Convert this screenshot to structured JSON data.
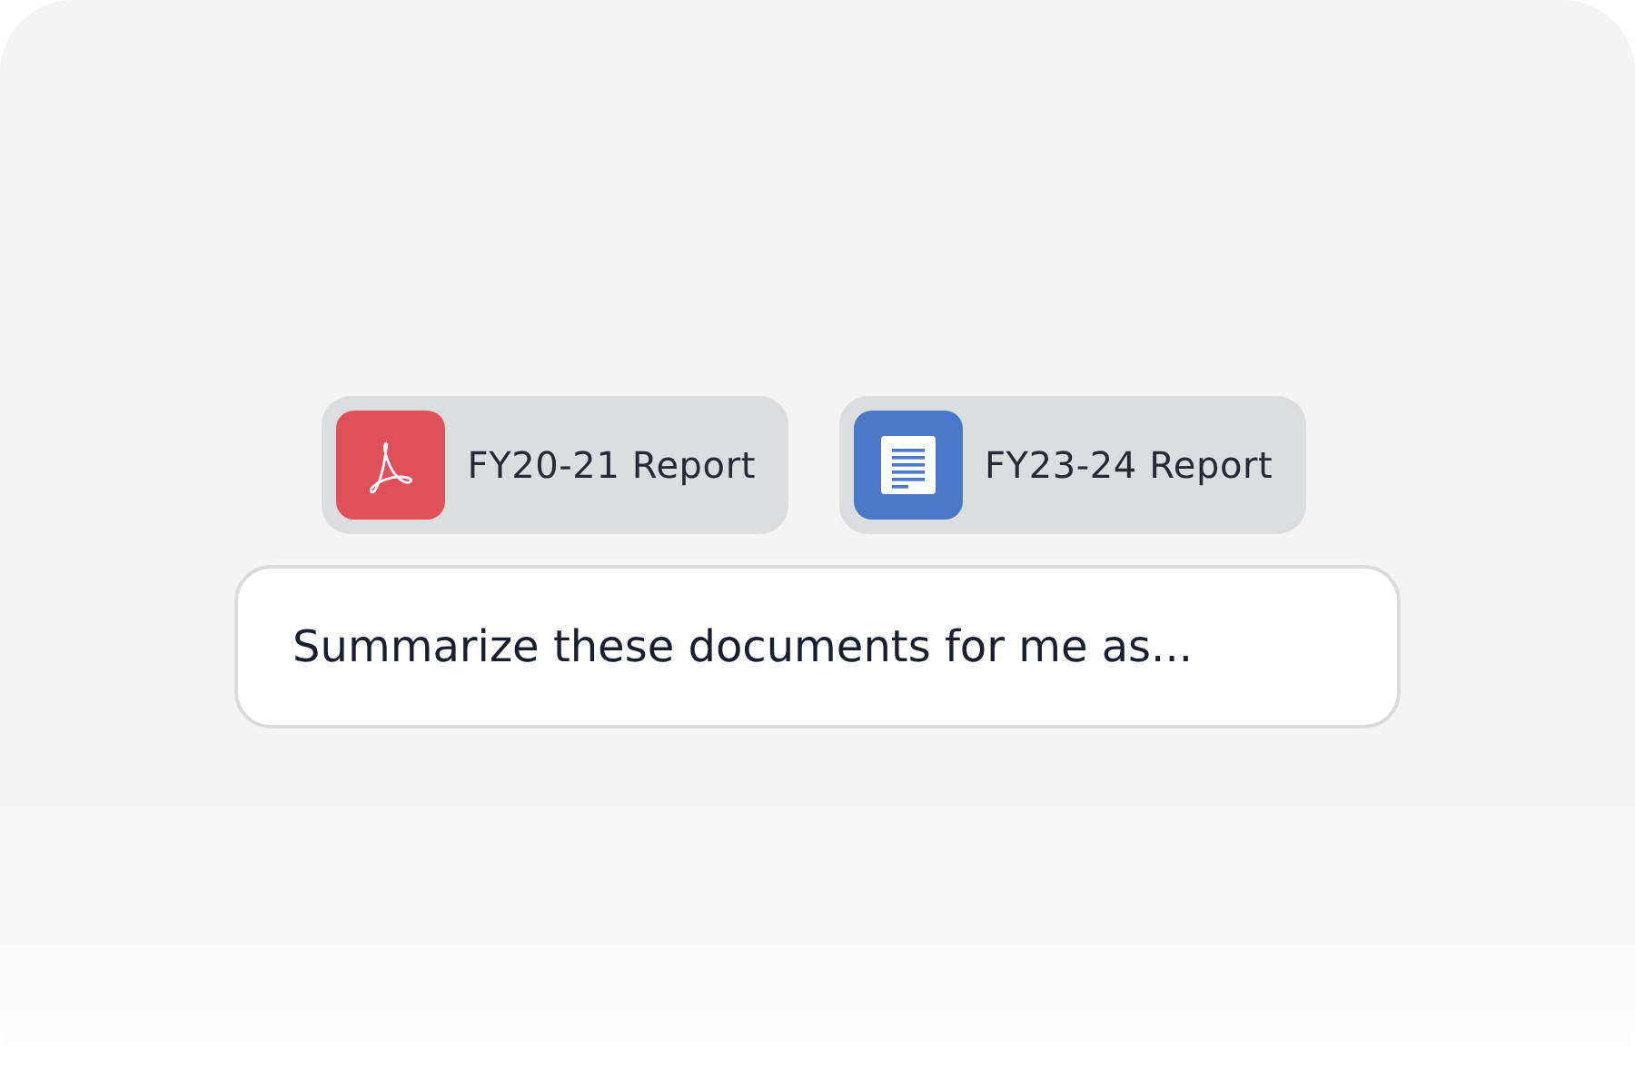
{
  "attachments": [
    {
      "kind": "pdf",
      "name": "FY20-21 Report",
      "color": "#e05058"
    },
    {
      "kind": "doc",
      "name": "FY23-24 Report",
      "color": "#4a78c8"
    }
  ],
  "prompt": {
    "value": "Summarize these documents for me as..."
  }
}
